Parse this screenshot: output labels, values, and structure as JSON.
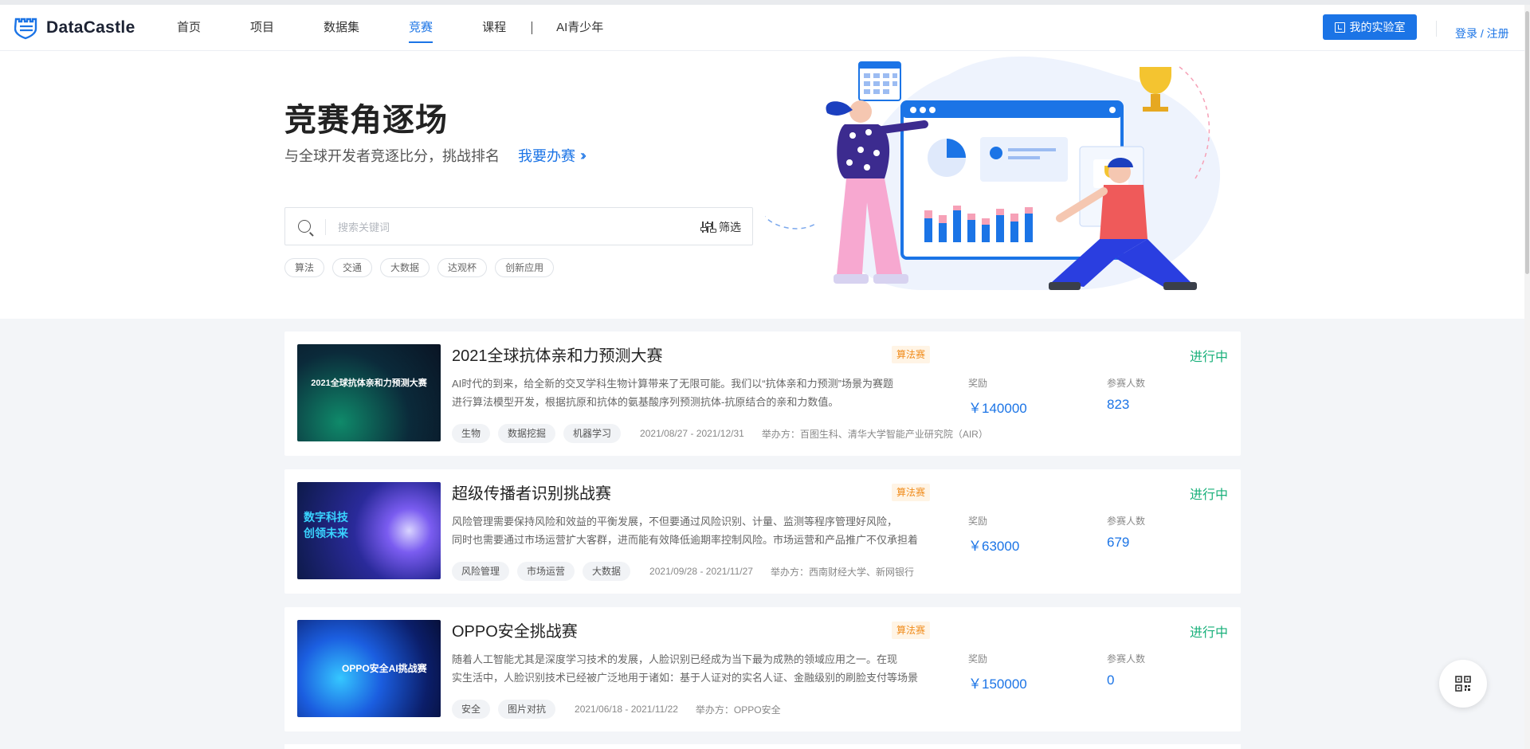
{
  "brand": {
    "name": "DataCastle"
  },
  "nav": {
    "items": [
      {
        "label": "首页",
        "active": false
      },
      {
        "label": "项目",
        "active": false
      },
      {
        "label": "数据集",
        "active": false
      },
      {
        "label": "竞赛",
        "active": true
      },
      {
        "label": "课程",
        "active": false
      }
    ],
    "extra": "AI青少年",
    "lab_button": "我的实验室",
    "login": "登录 / 注册"
  },
  "hero": {
    "title": "竞赛角逐场",
    "subtitle": "与全球开发者竞逐比分，挑战排名",
    "cta": "我要办赛",
    "search_placeholder": "搜索关键词",
    "filter_label": "筛选",
    "hot_tags": [
      "算法",
      "交通",
      "大数据",
      "达观杯",
      "创新应用"
    ]
  },
  "labels": {
    "reward": "奖励",
    "participants": "参赛人数"
  },
  "competitions": [
    {
      "thumb_title": "2021全球抗体亲和力预测大赛",
      "title": "2021全球抗体亲和力预测大赛",
      "type": "算法赛",
      "desc": [
        "AI时代的到来，给全新的交叉学科生物计算带来了无限可能。我们以“抗体亲和力预测”场景为赛题",
        "进行算法模型开发，根据抗原和抗体的氨基酸序列预测抗体-抗原结合的亲和力数值。"
      ],
      "tags": [
        "生物",
        "数据挖掘",
        "机器学习"
      ],
      "date": "2021/08/27 - 2021/12/31",
      "host": "举办方：百图生科、清华大学智能产业研究院（AIR）",
      "reward": "￥140000",
      "participants": "823",
      "status": "进行中"
    },
    {
      "thumb_title": "数字科技 创领未来",
      "title": "超级传播者识别挑战赛",
      "type": "算法赛",
      "desc": [
        "风险管理需要保持风险和效益的平衡发展，不但要通过风险识别、计量、监测等程序管理好风险，",
        "同时也需要通过市场运营扩大客群，进而能有效降低逾期率控制风险。市场运营和产品推广不仅承担着"
      ],
      "tags": [
        "风险管理",
        "市场运营",
        "大数据"
      ],
      "date": "2021/09/28 - 2021/11/27",
      "host": "举办方：西南财经大学、新网银行",
      "reward": "￥63000",
      "participants": "679",
      "status": "进行中"
    },
    {
      "thumb_title": "OPPO安全AI挑战赛",
      "title": "OPPO安全挑战赛",
      "type": "算法赛",
      "desc": [
        "随着人工智能尤其是深度学习技术的发展，人脸识别已经成为当下最为成熟的领域应用之一。在现",
        "实生活中，人脸识别技术已经被广泛地用于诸如：基于人证对的实名人证、金融级别的刷脸支付等场景"
      ],
      "tags": [
        "安全",
        "图片对抗"
      ],
      "date": "2021/06/18 - 2021/11/22",
      "host": "举办方：OPPO安全",
      "reward": "￥150000",
      "participants": "0",
      "status": "进行中"
    }
  ],
  "colors": {
    "primary": "#1b74e6",
    "status": "#18b07a",
    "type_tag": "#f08c1c"
  }
}
